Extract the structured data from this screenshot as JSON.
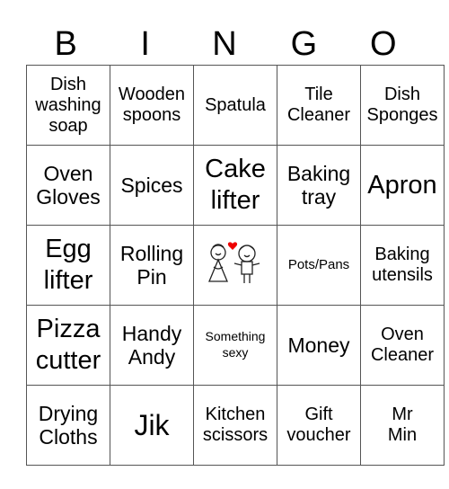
{
  "header": [
    "B",
    "I",
    "N",
    "G",
    "O"
  ],
  "rows": [
    [
      {
        "t": "Dish\nwashing\nsoap",
        "s": "s18"
      },
      {
        "t": "Wooden\nspoons",
        "s": "s18"
      },
      {
        "t": "Spatula",
        "s": "s18"
      },
      {
        "t": "Tile\nCleaner",
        "s": "s18"
      },
      {
        "t": "Dish\nSponges",
        "s": "s18"
      }
    ],
    [
      {
        "t": "Oven\nGloves",
        "s": "s22"
      },
      {
        "t": "Spices",
        "s": "s22"
      },
      {
        "t": "Cake\nlifter",
        "s": "s28"
      },
      {
        "t": "Baking\ntray",
        "s": "s22"
      },
      {
        "t": "Apron",
        "s": "s28"
      }
    ],
    [
      {
        "t": "Egg\nlifter",
        "s": "s28"
      },
      {
        "t": "Rolling\nPin",
        "s": "s22"
      },
      {
        "t": "",
        "s": "free",
        "icon": "bride-groom-icon"
      },
      {
        "t": "Pots/Pans",
        "s": "s15"
      },
      {
        "t": "Baking\nutensils",
        "s": "s18"
      }
    ],
    [
      {
        "t": "Pizza\ncutter",
        "s": "s28"
      },
      {
        "t": "Handy\nAndy",
        "s": "s22"
      },
      {
        "t": "Something\nsexy",
        "s": "s14"
      },
      {
        "t": "Money",
        "s": "s22"
      },
      {
        "t": "Oven\nCleaner",
        "s": "s18"
      }
    ],
    [
      {
        "t": "Drying\nCloths",
        "s": "s22"
      },
      {
        "t": "Jik",
        "s": "s34"
      },
      {
        "t": "Kitchen\nscissors",
        "s": "s18"
      },
      {
        "t": "Gift\nvoucher",
        "s": "s18"
      },
      {
        "t": "Mr\nMin",
        "s": "s18"
      }
    ]
  ]
}
